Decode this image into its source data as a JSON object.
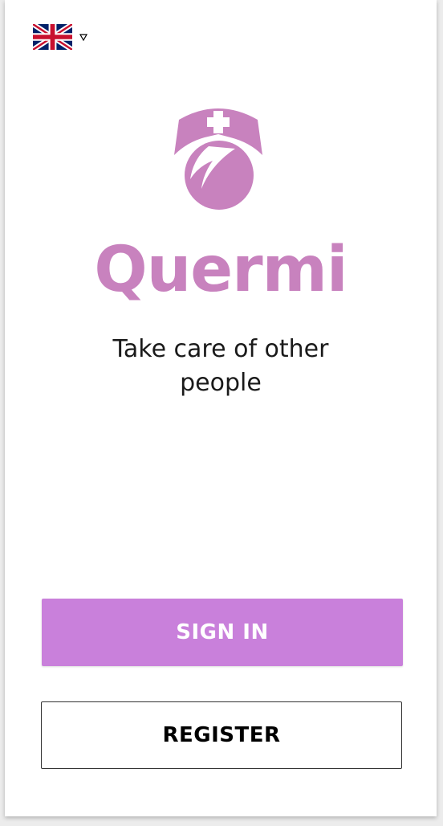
{
  "language": {
    "selected_icon": "uk-flag-icon",
    "dropdown_icon": "caret-down-icon"
  },
  "brand": {
    "logo_icon": "nurse-logo-icon",
    "name": "Quermi",
    "tagline_line1": "Take care of other",
    "tagline_line2": "people",
    "color": "#c882be"
  },
  "actions": {
    "sign_in_label": "SIGN IN",
    "register_label": "REGISTER",
    "accent_color": "#c980db"
  }
}
